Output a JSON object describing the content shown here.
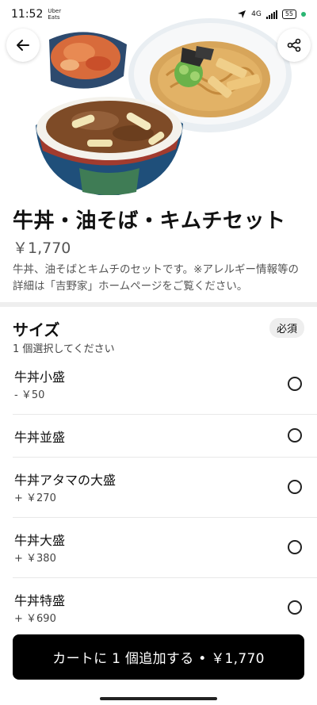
{
  "status_bar": {
    "time": "11:52",
    "app_label": "Uber\nEats",
    "network": "4G",
    "battery": "55"
  },
  "header": {
    "back_icon": "arrow-left-icon",
    "share_icon": "share-icon"
  },
  "item": {
    "title": "牛丼・油そば・キムチセット",
    "price": "￥1,770",
    "description": "牛丼、油そばとキムチのセットです。※アレルギー情報等の詳細は「吉野家」ホームページをご覧ください。"
  },
  "size_section": {
    "title": "サイズ",
    "required_label": "必須",
    "subtitle": "1 個選択してください",
    "options": [
      {
        "name": "牛丼小盛",
        "price": "- ￥50"
      },
      {
        "name": "牛丼並盛",
        "price": ""
      },
      {
        "name": "牛丼アタマの大盛",
        "price": "+ ￥270"
      },
      {
        "name": "牛丼大盛",
        "price": "+ ￥380"
      },
      {
        "name": "牛丼特盛",
        "price": "+ ￥690"
      }
    ]
  },
  "cart_button": {
    "label": "カートに 1 個追加する • ￥1,770"
  },
  "colors": {
    "primary_button": "#000000",
    "status_dot": "#2bb673"
  }
}
